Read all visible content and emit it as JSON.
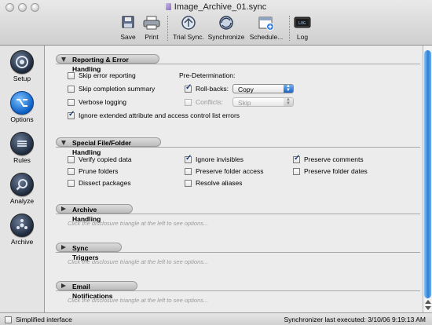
{
  "window": {
    "title": "Image_Archive_01.sync"
  },
  "toolbar": {
    "save": "Save",
    "print": "Print",
    "trial_sync": "Trial Sync.",
    "synchronize": "Synchronize",
    "schedule": "Schedule...",
    "log": "Log"
  },
  "sidebar": {
    "setup": "Setup",
    "options": "Options",
    "rules": "Rules",
    "analyze": "Analyze",
    "archive": "Archive"
  },
  "reporting": {
    "header": "Reporting & Error Handling",
    "skip_error": {
      "label": "Skip error reporting",
      "checked": false
    },
    "skip_completion": {
      "label": "Skip completion summary",
      "checked": false
    },
    "verbose": {
      "label": "Verbose logging",
      "checked": false
    },
    "ignore_ext": {
      "label": "Ignore extended attribute and access control list errors",
      "checked": true
    },
    "predet_label": "Pre-Determination:",
    "rollbacks": {
      "label": "Roll-backs:",
      "checked": true,
      "value": "Copy"
    },
    "conflicts": {
      "label": "Conflicts:",
      "checked": false,
      "value": "Skip"
    }
  },
  "special": {
    "header": "Special File/Folder Handling",
    "verify": {
      "label": "Verify copied data",
      "checked": false
    },
    "prune": {
      "label": "Prune folders",
      "checked": false
    },
    "dissect": {
      "label": "Dissect packages",
      "checked": false
    },
    "ignore_invisibles": {
      "label": "Ignore invisibles",
      "checked": true
    },
    "preserve_access": {
      "label": "Preserve folder access",
      "checked": false
    },
    "resolve_aliases": {
      "label": "Resolve aliases",
      "checked": false
    },
    "preserve_comments": {
      "label": "Preserve comments",
      "checked": true
    },
    "preserve_dates": {
      "label": "Preserve folder dates",
      "checked": false
    }
  },
  "archive_handling": {
    "header": "Archive Handling",
    "hint": "Click the disclosure triangle at the left to see options..."
  },
  "sync_triggers": {
    "header": "Sync Triggers",
    "hint": "Click the disclosure triangle at the left to see options..."
  },
  "email": {
    "header": "Email Notifications",
    "hint": "Click the disclosure triangle at the left to see options..."
  },
  "status": {
    "simplified": {
      "label": "Simplified interface",
      "checked": false
    },
    "last_executed": "Synchronizer last executed:  3/10/06 9:19:13 AM"
  }
}
